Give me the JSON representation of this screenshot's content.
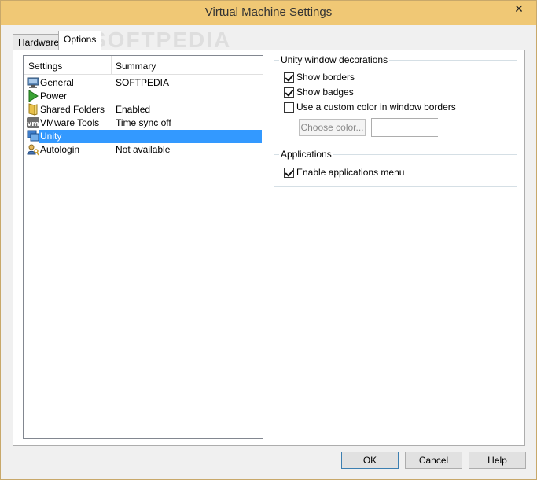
{
  "window": {
    "title": "Virtual Machine Settings",
    "close_glyph": "✕"
  },
  "tabs": [
    {
      "label": "Hardware",
      "active": false
    },
    {
      "label": "Options",
      "active": true
    }
  ],
  "watermark": "SOFTPEDIA",
  "settings_list": {
    "headers": {
      "settings": "Settings",
      "summary": "Summary"
    },
    "items": [
      {
        "name": "General",
        "summary": "SOFTPEDIA",
        "icon": "monitor-icon",
        "selected": false
      },
      {
        "name": "Power",
        "summary": "",
        "icon": "play-icon",
        "selected": false
      },
      {
        "name": "Shared Folders",
        "summary": "Enabled",
        "icon": "folder-icon",
        "selected": false
      },
      {
        "name": "VMware Tools",
        "summary": "Time sync off",
        "icon": "vm-icon",
        "selected": false
      },
      {
        "name": "Unity",
        "summary": "",
        "icon": "unity-icon",
        "selected": true
      },
      {
        "name": "Autologin",
        "summary": "Not available",
        "icon": "user-key-icon",
        "selected": false
      }
    ]
  },
  "unity_decorations": {
    "title": "Unity window decorations",
    "show_borders": {
      "label": "Show borders",
      "checked": true
    },
    "show_badges": {
      "label": "Show badges",
      "checked": true
    },
    "custom_color": {
      "label": "Use a custom color in window borders",
      "checked": false
    },
    "choose_color_label": "Choose color..."
  },
  "applications": {
    "title": "Applications",
    "enable_menu": {
      "label": "Enable applications menu",
      "checked": true
    }
  },
  "buttons": {
    "ok": "OK",
    "cancel": "Cancel",
    "help": "Help"
  },
  "colors": {
    "titlebar": "#f0c875",
    "selection": "#3399ff"
  }
}
